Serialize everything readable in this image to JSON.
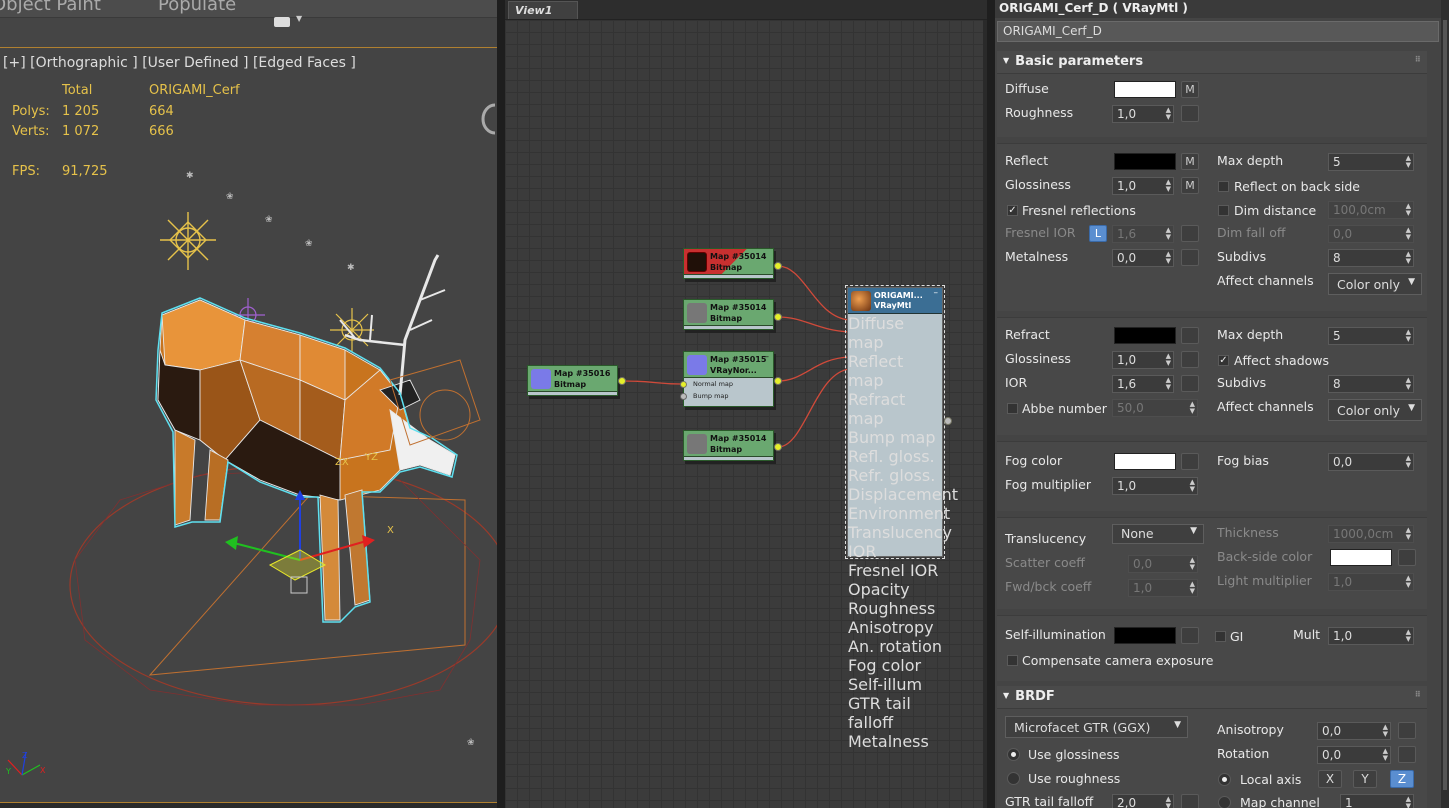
{
  "viewport": {
    "ribbon": {
      "tab1": "Object Paint",
      "tab2": "Populate"
    },
    "label": "[+] [Orthographic ] [User Defined ] [Edged Faces ]",
    "stats": {
      "col_total": "Total",
      "col_object": "ORIGAMI_Cerf",
      "polys_label": "Polys:",
      "polys_total": "1 205",
      "polys_object": "664",
      "verts_label": "Verts:",
      "verts_total": "1 072",
      "verts_object": "666",
      "fps_label": "FPS:",
      "fps_value": "91,725"
    },
    "gizmo_labels": {
      "x": "X",
      "y": "Y",
      "z": "Z",
      "yz": "YZ",
      "zx": "ZX"
    }
  },
  "slate": {
    "tab": "View1",
    "nodes": [
      {
        "title": "Map #35014",
        "sub": "Bitmap"
      },
      {
        "title": "Map #35014",
        "sub": "Bitmap"
      },
      {
        "title": "Map #35015",
        "sub": "VRayNor...",
        "slots": [
          "Normal map",
          "Bump map"
        ]
      },
      {
        "title": "Map #35016",
        "sub": "Bitmap"
      },
      {
        "title": "Map #35014",
        "sub": "Bitmap"
      }
    ],
    "material_node": {
      "title": "ORIGAMI...",
      "sub": "VRayMtl",
      "slots": [
        "Diffuse map",
        "Reflect map",
        "Refract map",
        "Bump map",
        "Refl. gloss.",
        "Refr. gloss.",
        "Displacement",
        "Environment",
        "Translucency",
        "IOR",
        "Fresnel IOR",
        "Opacity",
        "Roughness",
        "Anisotropy",
        "An. rotation",
        "Fog color",
        "Self-illum",
        "GTR tail falloff",
        "Metalness"
      ]
    }
  },
  "material": {
    "title": "ORIGAMI_Cerf_D  ( VRayMtl )",
    "name": "ORIGAMI_Cerf_D",
    "basic": {
      "header": "Basic parameters",
      "diffuse": "Diffuse",
      "roughness": "Roughness",
      "roughness_val": "1,0",
      "reflect": "Reflect",
      "glossiness": "Glossiness",
      "glossiness_val": "1,0",
      "fresnel": "Fresnel reflections",
      "fresnel_ior": "Fresnel IOR",
      "fresnel_ior_val": "1,6",
      "metalness": "Metalness",
      "metalness_val": "0,0",
      "max_depth": "Max depth",
      "max_depth_val": "5",
      "reflect_back": "Reflect on back side",
      "dim_distance": "Dim distance",
      "dim_distance_val": "100,0cm",
      "dim_falloff": "Dim fall off",
      "dim_falloff_val": "0,0",
      "subdivs": "Subdivs",
      "subdivs_val": "8",
      "affect_channels": "Affect channels",
      "affect_channels_val": "Color only",
      "refract": "Refract",
      "refr_gloss": "Glossiness",
      "refr_gloss_val": "1,0",
      "ior": "IOR",
      "ior_val": "1,6",
      "abbe": "Abbe number",
      "abbe_val": "50,0",
      "refr_max_depth": "Max depth",
      "refr_max_depth_val": "5",
      "affect_shadows": "Affect shadows",
      "refr_subdivs": "Subdivs",
      "refr_subdivs_val": "8",
      "refr_affect_channels": "Affect channels",
      "refr_affect_channels_val": "Color only",
      "fog_color": "Fog color",
      "fog_multiplier": "Fog multiplier",
      "fog_multiplier_val": "1,0",
      "fog_bias": "Fog bias",
      "fog_bias_val": "0,0",
      "translucency": "Translucency",
      "translucency_val": "None",
      "scatter": "Scatter coeff",
      "scatter_val": "0,0",
      "fwd_bck": "Fwd/bck coeff",
      "fwd_bck_val": "1,0",
      "thickness": "Thickness",
      "thickness_val": "1000,0cm",
      "back_side_color": "Back-side color",
      "light_mult": "Light multiplier",
      "light_mult_val": "1,0",
      "self_illum": "Self-illumination",
      "gi": "GI",
      "mult": "Mult",
      "mult_val": "1,0",
      "compensate": "Compensate camera exposure",
      "m_btn": "M",
      "l_btn": "L"
    },
    "brdf": {
      "header": "BRDF",
      "type_val": "Microfacet GTR (GGX)",
      "use_glossiness": "Use glossiness",
      "use_roughness": "Use roughness",
      "gtr_tail": "GTR tail falloff",
      "gtr_tail_val": "2,0",
      "anisotropy": "Anisotropy",
      "anisotropy_val": "0,0",
      "rotation": "Rotation",
      "rotation_val": "0,0",
      "local_axis": "Local axis",
      "axis_x": "X",
      "axis_y": "Y",
      "axis_z": "Z",
      "map_channel": "Map channel",
      "map_channel_val": "1"
    }
  }
}
